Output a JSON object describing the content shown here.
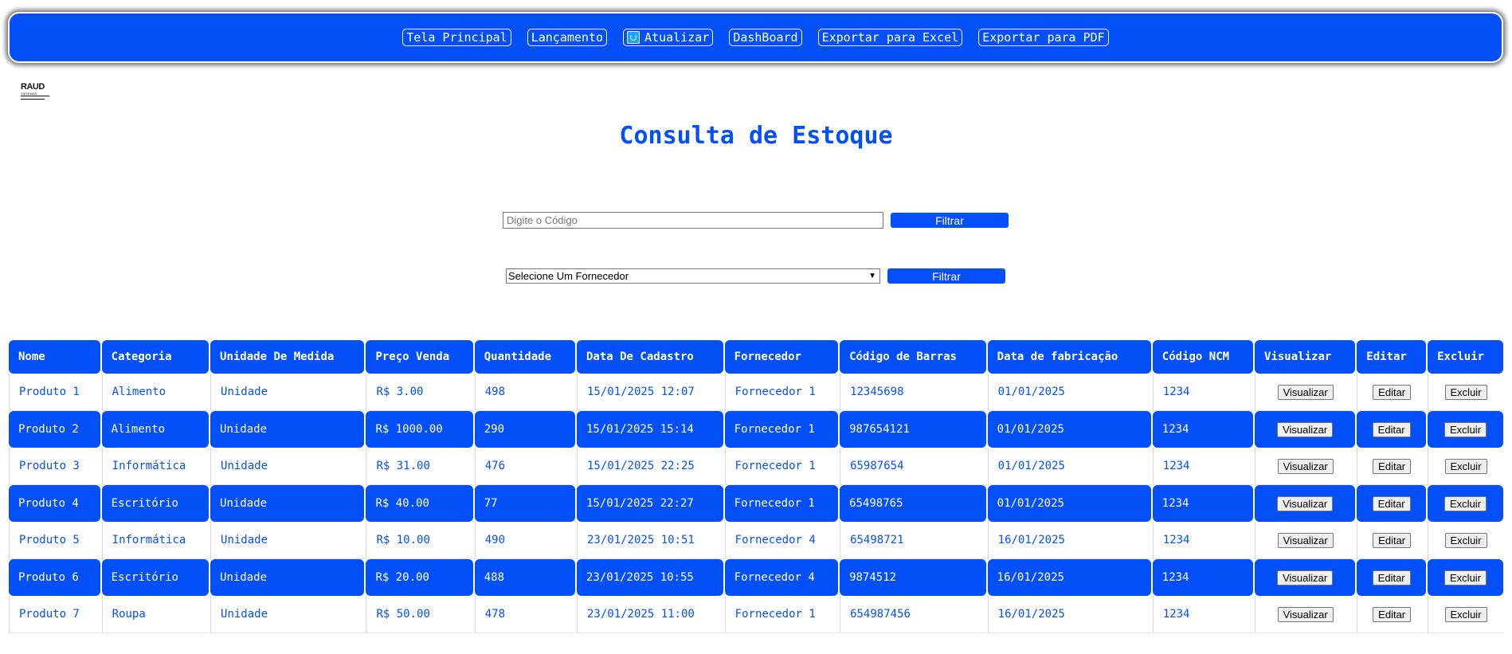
{
  "nav": {
    "items": [
      {
        "label": "Tela Principal"
      },
      {
        "label": "Lançamento"
      },
      {
        "label": "Atualizar",
        "icon": "refresh-icon"
      },
      {
        "label": "DashBoard"
      },
      {
        "label": "Exportar para Excel"
      },
      {
        "label": "Exportar para PDF"
      }
    ]
  },
  "logo": {
    "line1": "RAUD",
    "line2": "SISTEMAS"
  },
  "page_title": "Consulta de Estoque",
  "filter_code": {
    "placeholder": "Digite o Código",
    "value": "",
    "button": "Filtrar"
  },
  "filter_supplier": {
    "selected": "Selecione Um Fornecedor",
    "button": "Filtrar"
  },
  "colors": {
    "accent": "#0450f8",
    "text_on_accent": "#ffffff"
  },
  "table": {
    "headers": [
      "Nome",
      "Categoria",
      "Unidade De Medida",
      "Preço Venda",
      "Quantidade",
      "Data De Cadastro",
      "Fornecedor",
      "Código de Barras",
      "Data de fabricação",
      "Código NCM",
      "Visualizar",
      "Editar",
      "Excluir"
    ],
    "action_labels": {
      "view": "Visualizar",
      "edit": "Editar",
      "delete": "Excluir"
    },
    "rows": [
      {
        "nome": "Produto 1",
        "categoria": "Alimento",
        "unidade": "Unidade",
        "preco": "R$ 3.00",
        "quantidade": "498",
        "cadastro": "15/01/2025 12:07",
        "fornecedor": "Fornecedor 1",
        "barras": "12345698",
        "fabricacao": "01/01/2025",
        "ncm": "1234"
      },
      {
        "nome": "Produto 2",
        "categoria": "Alimento",
        "unidade": "Unidade",
        "preco": "R$ 1000.00",
        "quantidade": "290",
        "cadastro": "15/01/2025 15:14",
        "fornecedor": "Fornecedor 1",
        "barras": "987654121",
        "fabricacao": "01/01/2025",
        "ncm": "1234"
      },
      {
        "nome": "Produto 3",
        "categoria": "Informática",
        "unidade": "Unidade",
        "preco": "R$ 31.00",
        "quantidade": "476",
        "cadastro": "15/01/2025 22:25",
        "fornecedor": "Fornecedor 1",
        "barras": "65987654",
        "fabricacao": "01/01/2025",
        "ncm": "1234"
      },
      {
        "nome": "Produto 4",
        "categoria": "Escritório",
        "unidade": "Unidade",
        "preco": "R$ 40.00",
        "quantidade": "77",
        "cadastro": "15/01/2025 22:27",
        "fornecedor": "Fornecedor 1",
        "barras": "65498765",
        "fabricacao": "01/01/2025",
        "ncm": "1234"
      },
      {
        "nome": "Produto 5",
        "categoria": "Informática",
        "unidade": "Unidade",
        "preco": "R$ 10.00",
        "quantidade": "490",
        "cadastro": "23/01/2025 10:51",
        "fornecedor": "Fornecedor 4",
        "barras": "65498721",
        "fabricacao": "16/01/2025",
        "ncm": "1234"
      },
      {
        "nome": "Produto 6",
        "categoria": "Escritório",
        "unidade": "Unidade",
        "preco": "R$ 20.00",
        "quantidade": "488",
        "cadastro": "23/01/2025 10:55",
        "fornecedor": "Fornecedor 4",
        "barras": "9874512",
        "fabricacao": "16/01/2025",
        "ncm": "1234"
      },
      {
        "nome": "Produto 7",
        "categoria": "Roupa",
        "unidade": "Unidade",
        "preco": "R$ 50.00",
        "quantidade": "478",
        "cadastro": "23/01/2025 11:00",
        "fornecedor": "Fornecedor 1",
        "barras": "654987456",
        "fabricacao": "16/01/2025",
        "ncm": "1234"
      }
    ]
  }
}
